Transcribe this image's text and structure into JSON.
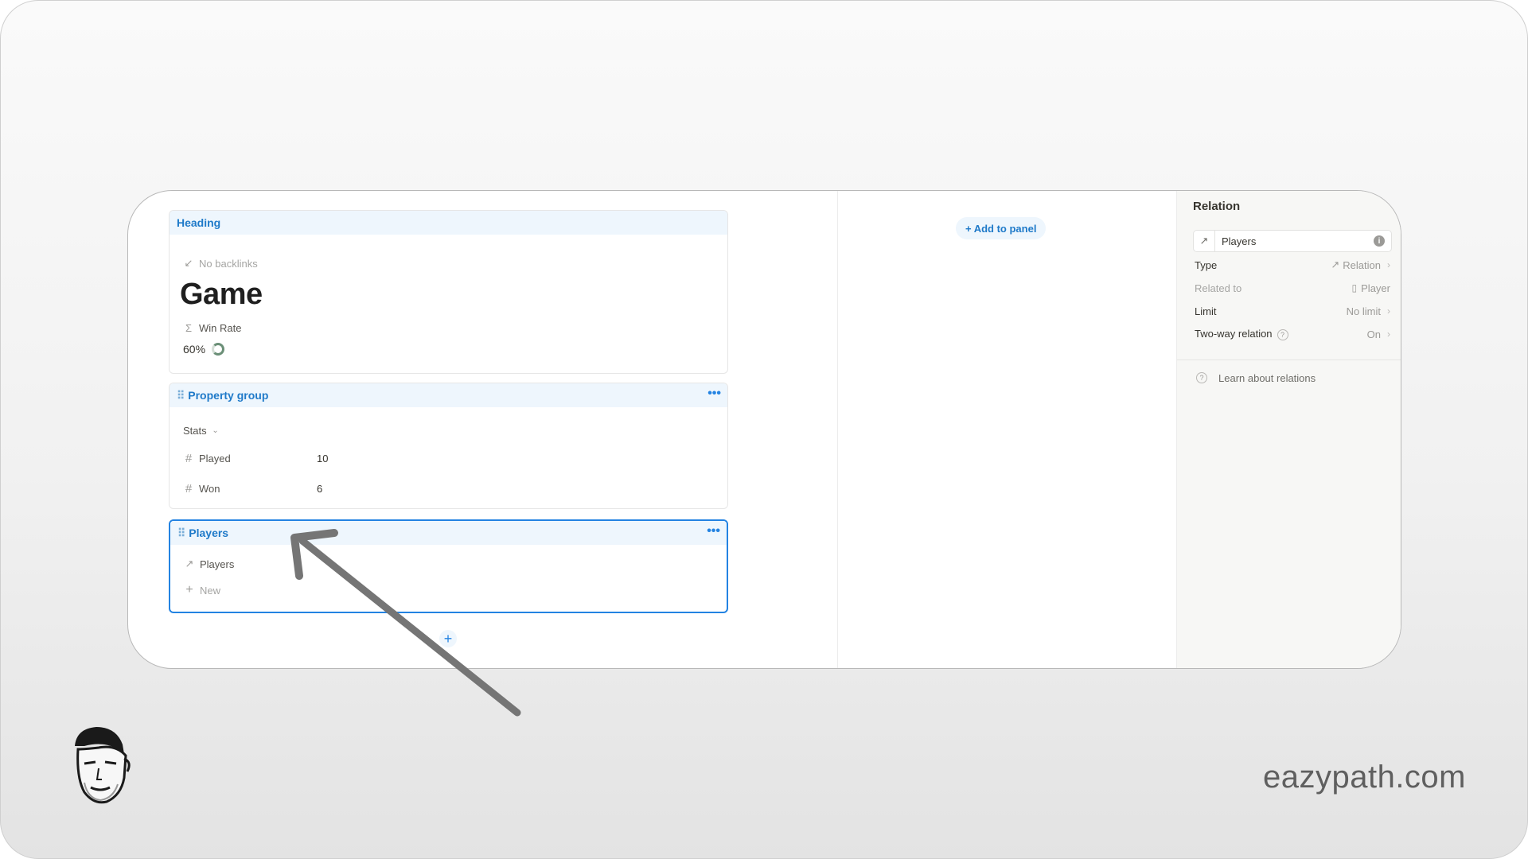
{
  "heading_block": {
    "label": "Heading",
    "backlinks": "No backlinks",
    "title": "Game",
    "formula_label": "Win Rate",
    "formula_value": "60%",
    "progress_fraction": 0.6
  },
  "property_group": {
    "label": "Property group",
    "section": "Stats",
    "properties": [
      {
        "name": "Played",
        "value": "10"
      },
      {
        "name": "Won",
        "value": "6"
      }
    ]
  },
  "players_block": {
    "label": "Players",
    "relation_name": "Players",
    "new_label": "New"
  },
  "middle": {
    "add_to_panel": "+ Add to panel"
  },
  "relation_panel": {
    "title": "Relation",
    "name_value": "Players",
    "rows": [
      {
        "label": "Type",
        "value": "Relation"
      },
      {
        "label": "Related to",
        "value": "Player"
      },
      {
        "label": "Limit",
        "value": "No limit"
      },
      {
        "label": "Two-way relation",
        "value": "On"
      }
    ],
    "learn_link": "Learn about relations"
  },
  "brand": "eazypath.com",
  "colors": {
    "accent": "#2383e2",
    "block_header_bg": "#eef6fd",
    "panel_bg": "#f7f7f5"
  },
  "icons": [
    "backlink-icon",
    "sigma-icon",
    "drag-handle-icon",
    "more-icon",
    "hash-icon",
    "chevron-down-icon",
    "relation-arrow-icon",
    "plus-icon",
    "info-icon",
    "question-icon",
    "page-icon",
    "chevron-right-icon"
  ]
}
